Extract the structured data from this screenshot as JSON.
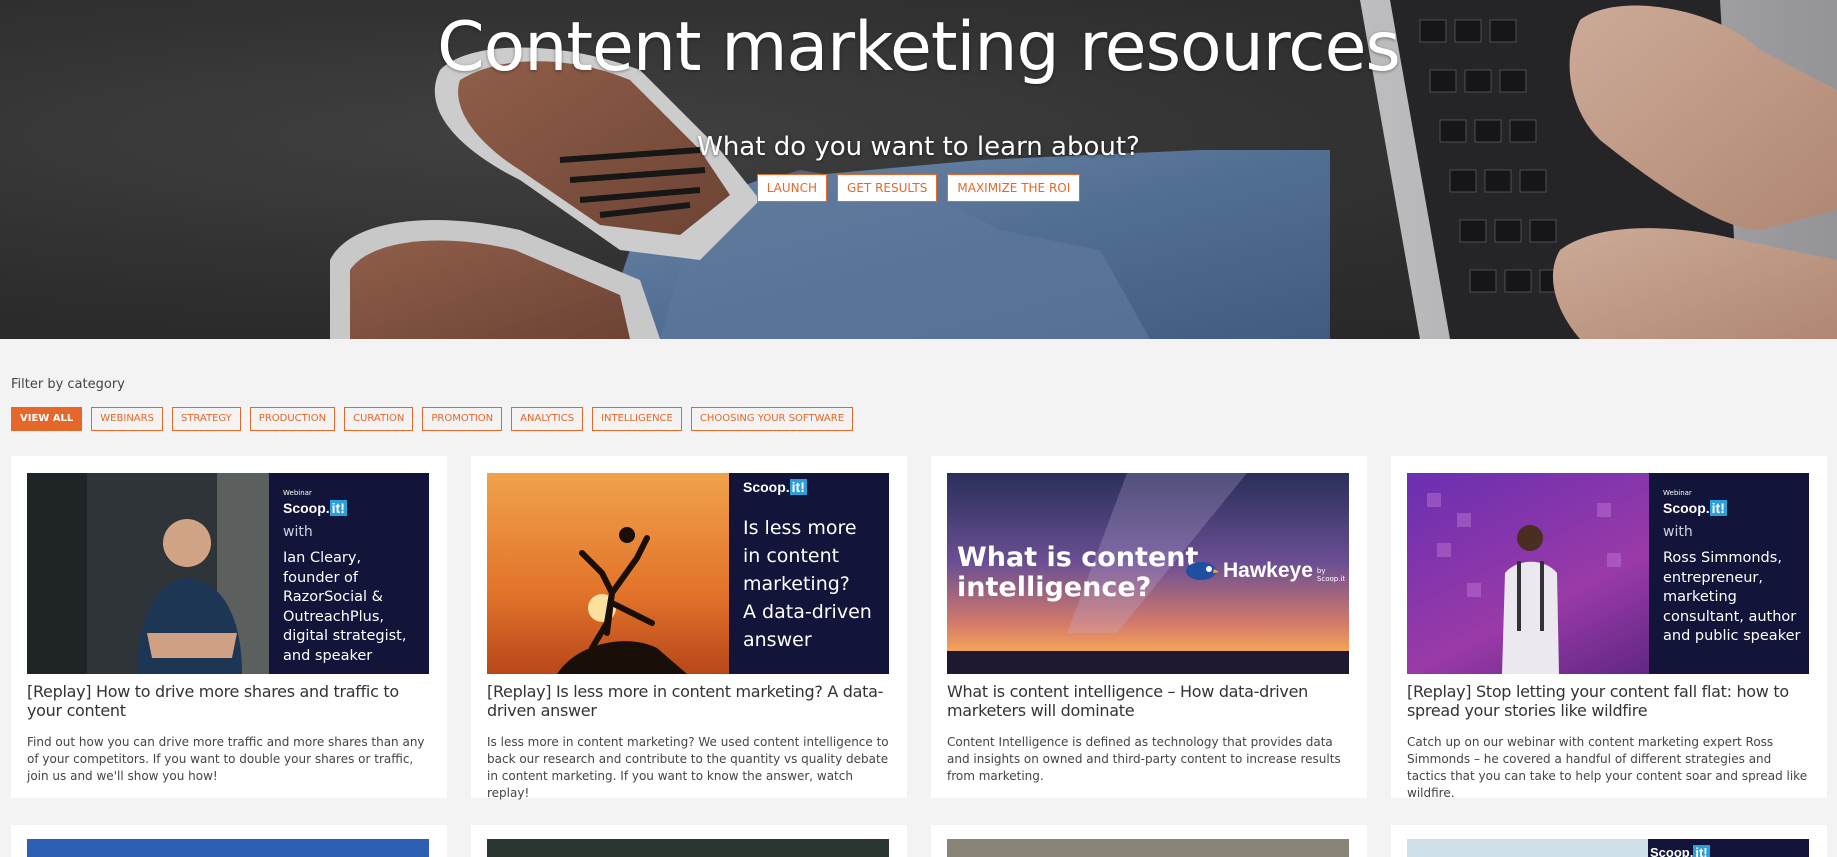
{
  "hero": {
    "title": "Content marketing resources",
    "subtitle": "What do you want to learn about?",
    "buttons": [
      "LAUNCH",
      "GET RESULTS",
      "MAXIMIZE THE ROI"
    ]
  },
  "filter": {
    "label": "Filter by category",
    "items": [
      "VIEW ALL",
      "WEBINARS",
      "STRATEGY",
      "PRODUCTION",
      "CURATION",
      "PROMOTION",
      "ANALYTICS",
      "INTELLIGENCE",
      "CHOOSING YOUR SOFTWARE"
    ],
    "active": "VIEW ALL"
  },
  "cards": [
    {
      "title": "[Replay] How to drive more shares and traffic to your content",
      "description": "Find out how you can drive more traffic and more shares than any of your competitors.  If you want to double your shares or traffic, join us and we'll show you how!",
      "thumb": {
        "tag": "Webinar",
        "brand": "Scoop.",
        "brand_it": "it!",
        "with": "with",
        "lines": [
          "Ian Cleary,",
          "founder of",
          "RazorSocial &",
          "OutreachPlus,",
          "digital strategist,",
          "and speaker"
        ]
      }
    },
    {
      "title": "[Replay] Is less more in content marketing? A data-driven answer",
      "description": "Is less more in content marketing? We used content intelligence to back our research and contribute to the quantity vs quality debate in content marketing. If you want to know the answer, watch replay!",
      "thumb": {
        "brand": "Scoop.",
        "brand_it": "it!",
        "lines": [
          "Is less more",
          "in content",
          "marketing?",
          "A data-driven",
          "answer"
        ]
      }
    },
    {
      "title": "What is content intelligence – How data-driven marketers will dominate",
      "description": "Content Intelligence is defined as technology that provides data and insights on owned and third-party content to increase results from marketing.",
      "thumb": {
        "lines": [
          "What is content",
          "intelligence?"
        ],
        "logo": "Hawkeye",
        "logo_sub": "by Scoop.it"
      }
    },
    {
      "title": "[Replay] Stop letting your content fall flat: how to spread your stories like wildfire",
      "description": "Catch up on our webinar with content marketing expert Ross Simmonds – he covered a handful of different strategies and tactics that you can take to help your content soar and spread like wildfire.",
      "thumb": {
        "tag": "Webinar",
        "brand": "Scoop.",
        "brand_it": "it!",
        "with": "with",
        "lines": [
          "Ross Simmonds,",
          "entrepreneur,",
          "marketing",
          "consultant, author",
          "and public speaker"
        ]
      }
    }
  ],
  "row2_brand": {
    "brand": "Scoop.",
    "brand_it": "it!"
  },
  "colors": {
    "accent": "#e5672a",
    "panel": "#12143a",
    "page_bg": "#f3f3f3"
  }
}
